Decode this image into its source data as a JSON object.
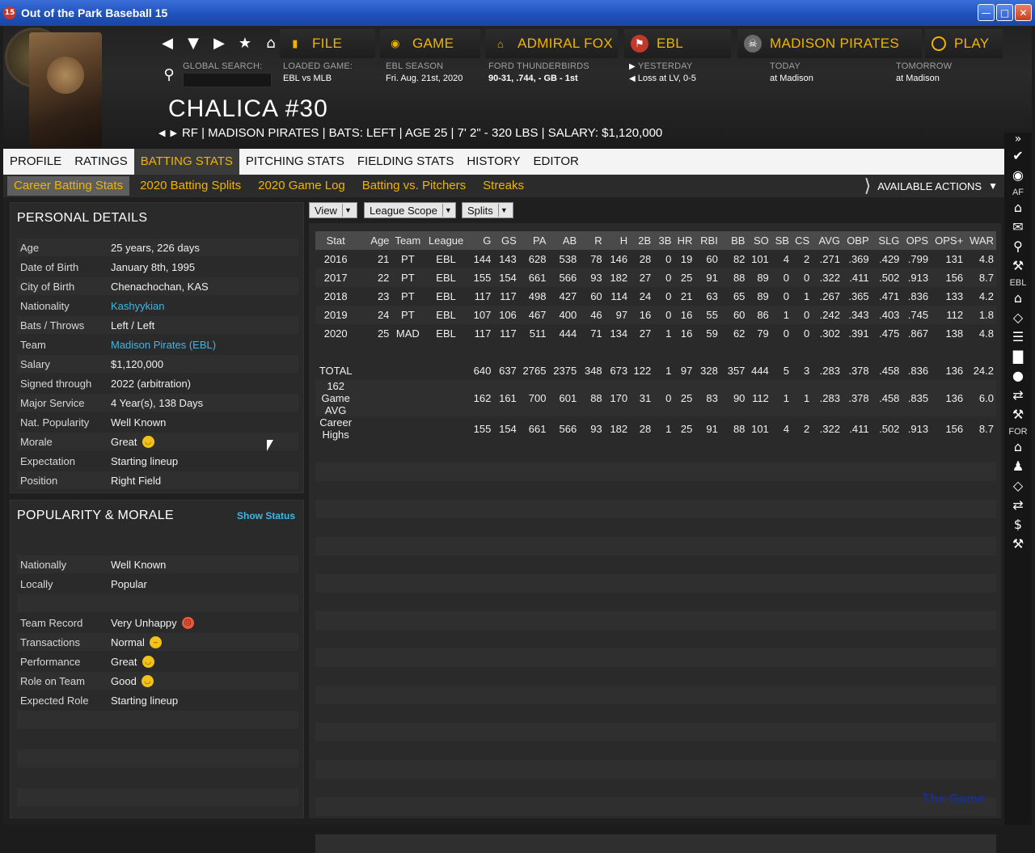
{
  "window": {
    "title": "Out of the Park Baseball 15",
    "app_icon": "15",
    "controls": [
      "minimize",
      "maximize",
      "close"
    ]
  },
  "header": {
    "menus": [
      {
        "label": "FILE",
        "icon": "document-icon"
      },
      {
        "label": "GAME",
        "icon": "globe-icon"
      },
      {
        "label": "ADMIRAL FOX",
        "icon": "home-icon"
      },
      {
        "label": "EBL",
        "icon": "league-logo-icon"
      },
      {
        "label": "MADISON PIRATES",
        "icon": "team-logo-icon"
      },
      {
        "label": "PLAY",
        "icon": "baseball-icon"
      }
    ],
    "global_search_label": "GLOBAL SEARCH:",
    "loaded_game": {
      "label": "LOADED GAME:",
      "value": "EBL vs MLB"
    },
    "season": {
      "label": "EBL SEASON",
      "value": "Fri. Aug. 21st, 2020"
    },
    "team_record": {
      "label": "FORD THUNDERBIRDS",
      "value": "90-31, .744, - GB - 1st"
    },
    "yesterday": {
      "label": "YESTERDAY",
      "value": "Loss at LV, 0-5"
    },
    "today": {
      "label": "TODAY",
      "value": "at Madison"
    },
    "tomorrow": {
      "label": "TOMORROW",
      "value": "at Madison"
    }
  },
  "player": {
    "name": "CHALICA  #30",
    "info": "RF | MADISON PIRATES | BATS: LEFT | AGE 25 | 7' 2\" - 320 LBS | SALARY: $1,120,000"
  },
  "tabs": [
    "PROFILE",
    "RATINGS",
    "BATTING STATS",
    "PITCHING STATS",
    "FIELDING STATS",
    "HISTORY",
    "EDITOR"
  ],
  "active_tab": "BATTING STATS",
  "subtabs": [
    "Career Batting Stats",
    "2020 Batting Splits",
    "2020 Game Log",
    "Batting vs. Pitchers",
    "Streaks"
  ],
  "available_actions": "AVAILABLE ACTIONS",
  "personal_details": {
    "title": "PERSONAL DETAILS",
    "rows": [
      {
        "k": "Age",
        "v": "25 years, 226 days"
      },
      {
        "k": "Date of Birth",
        "v": "January 8th, 1995"
      },
      {
        "k": "City of Birth",
        "v": "Chenachochan, KAS"
      },
      {
        "k": "Nationality",
        "v": "Kashyykian",
        "link": true
      },
      {
        "k": "Bats / Throws",
        "v": "Left / Left"
      },
      {
        "k": "Team",
        "v": "Madison Pirates (EBL)",
        "link": true
      },
      {
        "k": "Salary",
        "v": "$1,120,000"
      },
      {
        "k": "Signed through",
        "v": "2022 (arbitration)"
      },
      {
        "k": "Major Service",
        "v": "4 Year(s), 138 Days"
      },
      {
        "k": "Nat. Popularity",
        "v": "Well Known"
      },
      {
        "k": "Morale",
        "v": "Great",
        "emoji": "happy"
      },
      {
        "k": "Expectation",
        "v": "Starting lineup"
      },
      {
        "k": "Position",
        "v": "Right Field"
      }
    ]
  },
  "popularity": {
    "title": "POPULARITY & MORALE",
    "show_status": "Show Status",
    "rows": [
      {
        "k": "Nationally",
        "v": "Well Known"
      },
      {
        "k": "Locally",
        "v": "Popular"
      },
      {
        "k": "",
        "v": ""
      },
      {
        "k": "Team Record",
        "v": "Very Unhappy",
        "emoji": "mad"
      },
      {
        "k": "Transactions",
        "v": "Normal",
        "emoji": "neutral"
      },
      {
        "k": "Performance",
        "v": "Great",
        "emoji": "happy"
      },
      {
        "k": "Role on Team",
        "v": "Good",
        "emoji": "happy"
      },
      {
        "k": "Expected Role",
        "v": "Starting lineup"
      }
    ]
  },
  "filters": [
    "View",
    "League Scope",
    "Splits"
  ],
  "stats": {
    "columns": [
      "Stat",
      "Age",
      "Team",
      "League",
      "G",
      "GS",
      "PA",
      "AB",
      "R",
      "H",
      "2B",
      "3B",
      "HR",
      "RBI",
      "BB",
      "SO",
      "SB",
      "CS",
      "AVG",
      "OBP",
      "SLG",
      "OPS",
      "OPS+",
      "WAR"
    ],
    "rows": [
      [
        "2016",
        "21",
        "PT",
        "EBL",
        "144",
        "143",
        "628",
        "538",
        "78",
        "146",
        "28",
        "0",
        "19",
        "60",
        "82",
        "101",
        "4",
        "2",
        ".271",
        ".369",
        ".429",
        ".799",
        "131",
        "4.8"
      ],
      [
        "2017",
        "22",
        "PT",
        "EBL",
        "155",
        "154",
        "661",
        "566",
        "93",
        "182",
        "27",
        "0",
        "25",
        "91",
        "88",
        "89",
        "0",
        "0",
        ".322",
        ".411",
        ".502",
        ".913",
        "156",
        "8.7"
      ],
      [
        "2018",
        "23",
        "PT",
        "EBL",
        "117",
        "117",
        "498",
        "427",
        "60",
        "114",
        "24",
        "0",
        "21",
        "63",
        "65",
        "89",
        "0",
        "1",
        ".267",
        ".365",
        ".471",
        ".836",
        "133",
        "4.2"
      ],
      [
        "2019",
        "24",
        "PT",
        "EBL",
        "107",
        "106",
        "467",
        "400",
        "46",
        "97",
        "16",
        "0",
        "16",
        "55",
        "60",
        "86",
        "1",
        "0",
        ".242",
        ".343",
        ".403",
        ".745",
        "112",
        "1.8"
      ],
      [
        "2020",
        "25",
        "MAD",
        "EBL",
        "117",
        "117",
        "511",
        "444",
        "71",
        "134",
        "27",
        "1",
        "16",
        "59",
        "62",
        "79",
        "0",
        "0",
        ".302",
        ".391",
        ".475",
        ".867",
        "138",
        "4.8"
      ]
    ],
    "totals": [
      [
        "TOTAL",
        "",
        "",
        "",
        "640",
        "637",
        "2765",
        "2375",
        "348",
        "673",
        "122",
        "1",
        "97",
        "328",
        "357",
        "444",
        "5",
        "3",
        ".283",
        ".378",
        ".458",
        ".836",
        "136",
        "24.2"
      ],
      [
        "162 Game AVG",
        "",
        "",
        "",
        "162",
        "161",
        "700",
        "601",
        "88",
        "170",
        "31",
        "0",
        "25",
        "83",
        "90",
        "112",
        "1",
        "1",
        ".283",
        ".378",
        ".458",
        ".835",
        "136",
        "6.0"
      ],
      [
        "Career Highs",
        "",
        "",
        "",
        "155",
        "154",
        "661",
        "566",
        "93",
        "182",
        "28",
        "1",
        "25",
        "91",
        "88",
        "101",
        "4",
        "2",
        ".322",
        ".411",
        ".502",
        ".913",
        "156",
        "8.7"
      ]
    ]
  },
  "right_rail": {
    "sections": [
      {
        "label": "",
        "icons": [
          "checkmark-icon",
          "globe-icon"
        ]
      },
      {
        "label": "AF",
        "icons": [
          "home-icon",
          "mail-icon",
          "search-icon",
          "wrench-icon"
        ]
      },
      {
        "label": "EBL",
        "icons": [
          "home-icon",
          "diamond-icon",
          "list-icon",
          "bar-chart-icon",
          "baseball-icon",
          "transfer-icon",
          "wrench-icon"
        ]
      },
      {
        "label": "FOR",
        "icons": [
          "home-icon",
          "player-icon",
          "diamond-icon",
          "transfer-icon",
          "dollar-icon",
          "wrench-icon"
        ]
      }
    ]
  },
  "watermark": "The Game",
  "colors": {
    "accent": "#f0b400",
    "link": "#3fb6e8",
    "titlebar": "#2356c4"
  }
}
